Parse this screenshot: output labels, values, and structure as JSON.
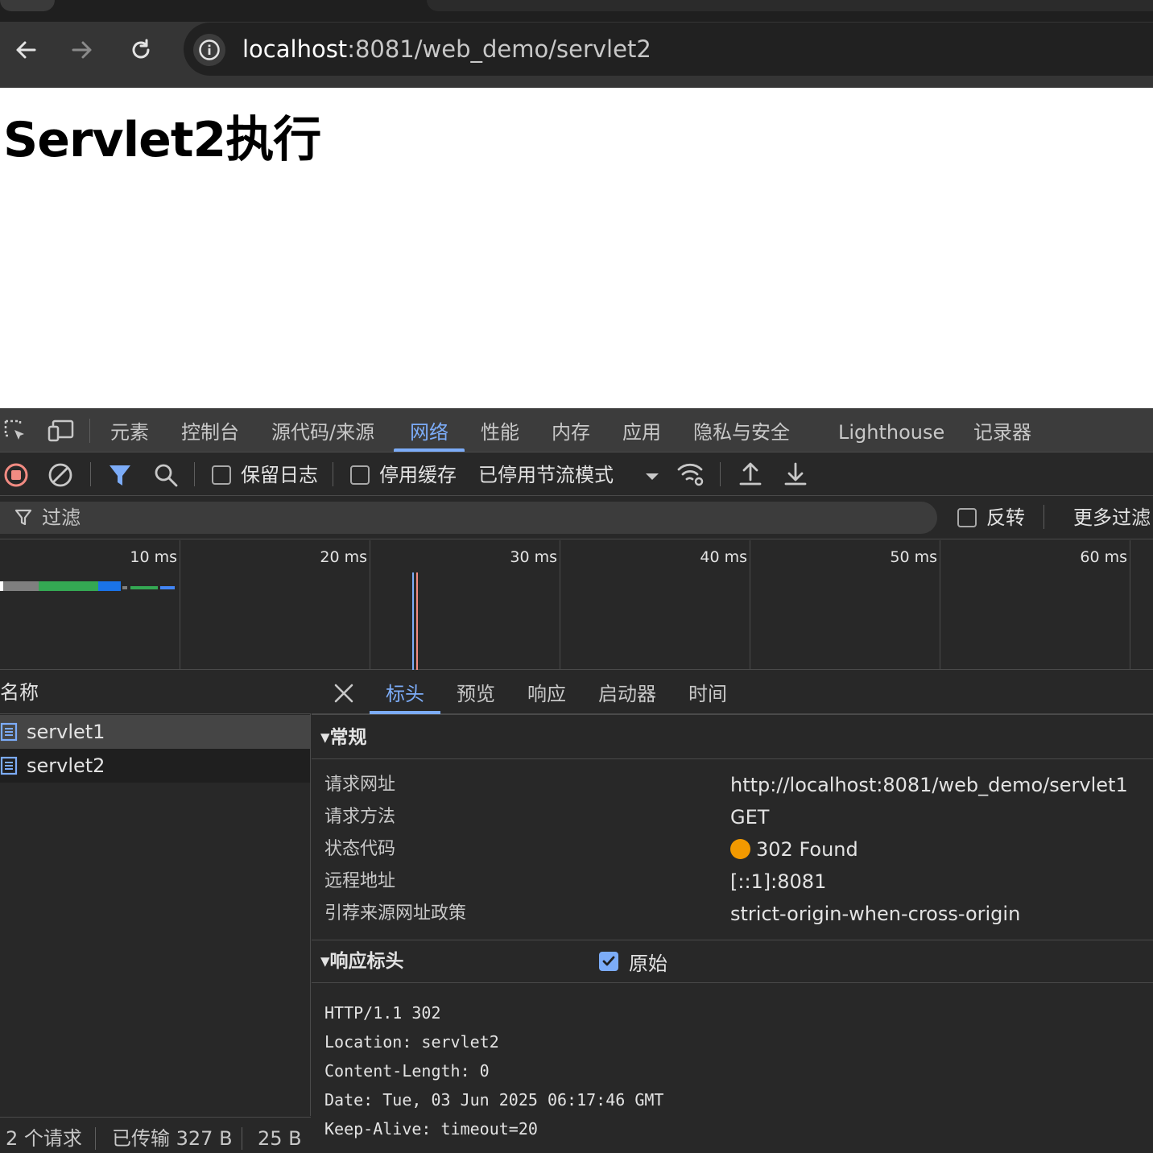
{
  "browser": {
    "url_host": "localhost",
    "url_rest": ":8081/web_demo/servlet2"
  },
  "page": {
    "heading": "Servlet2执行"
  },
  "devtools": {
    "tabs": [
      "元素",
      "控制台",
      "源代码/来源",
      "网络",
      "性能",
      "内存",
      "应用",
      "隐私与安全",
      "Lighthouse",
      "记录器"
    ],
    "active_tab": "网络",
    "toolbar": {
      "preserve_log": "保留日志",
      "disable_cache": "停用缓存",
      "throttling": "已停用节流模式"
    },
    "filter": {
      "placeholder": "过滤",
      "invert": "反转",
      "more_filters": "更多过滤"
    },
    "timeline": {
      "labels": [
        "10 ms",
        "20 ms",
        "30 ms",
        "40 ms",
        "50 ms",
        "60 ms"
      ]
    },
    "request_list": {
      "header": "名称",
      "requests": [
        {
          "name": "servlet1"
        },
        {
          "name": "servlet2"
        }
      ]
    },
    "status_bar": {
      "requests": "2 个请求",
      "transferred": "已传输 327 B",
      "resources": "25 B"
    },
    "detail": {
      "tabs": [
        "标头",
        "预览",
        "响应",
        "启动器",
        "时间"
      ],
      "active_tab": "标头",
      "general": {
        "title": "▾常规",
        "rows": [
          {
            "key": "请求网址",
            "value": "http://localhost:8081/web_demo/servlet1"
          },
          {
            "key": "请求方法",
            "value": "GET"
          },
          {
            "key": "状态代码",
            "value": "302 Found",
            "status_color": "#f29900"
          },
          {
            "key": "远程地址",
            "value": "[::1]:8081"
          },
          {
            "key": "引荐来源网址政策",
            "value": "strict-origin-when-cross-origin"
          }
        ]
      },
      "response_headers": {
        "title": "▾响应标头",
        "raw_label": "原始",
        "raw_checked": true,
        "lines": [
          "HTTP/1.1 302",
          "Location: servlet2",
          "Content-Length: 0",
          "Date: Tue, 03 Jun 2025 06:17:46 GMT",
          "Keep-Alive: timeout=20"
        ]
      }
    }
  }
}
